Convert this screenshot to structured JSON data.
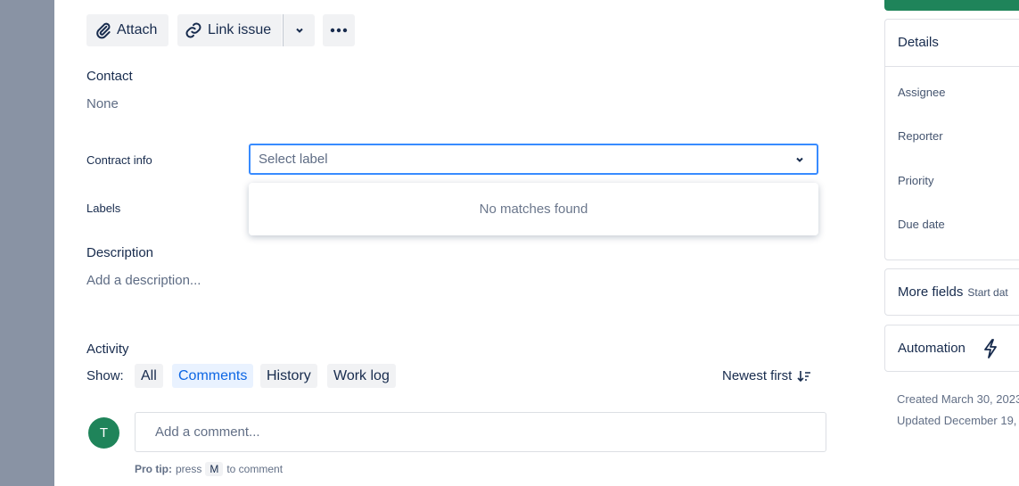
{
  "toolbar": {
    "attach": "Attach",
    "link_issue": "Link issue"
  },
  "contact": {
    "label": "Contact",
    "value": "None"
  },
  "contract_info": {
    "label": "Contract info",
    "placeholder": "Select label",
    "no_matches": "No matches found"
  },
  "labels": {
    "label": "Labels"
  },
  "description": {
    "label": "Description",
    "placeholder": "Add a description..."
  },
  "activity": {
    "title": "Activity",
    "show": "Show:",
    "tabs": [
      "All",
      "Comments",
      "History",
      "Work log"
    ],
    "active": "Comments",
    "sort": "Newest first",
    "avatar": "T",
    "comment_placeholder": "Add a comment...",
    "tip_bold": "Pro tip:",
    "tip_pre": "press",
    "tip_key": "M",
    "tip_post": "to comment"
  },
  "sidebar": {
    "details": "Details",
    "fields": [
      "Assignee",
      "Reporter",
      "Priority",
      "Due date"
    ],
    "more_fields": "More fields",
    "more_fields_hint": "Start dat",
    "automation": "Automation",
    "created": "Created March 30, 2023",
    "updated": "Updated December 19,"
  },
  "colors": {
    "accent": "#0c66e4",
    "green": "#1f845a",
    "avatar": "#1f845a"
  }
}
